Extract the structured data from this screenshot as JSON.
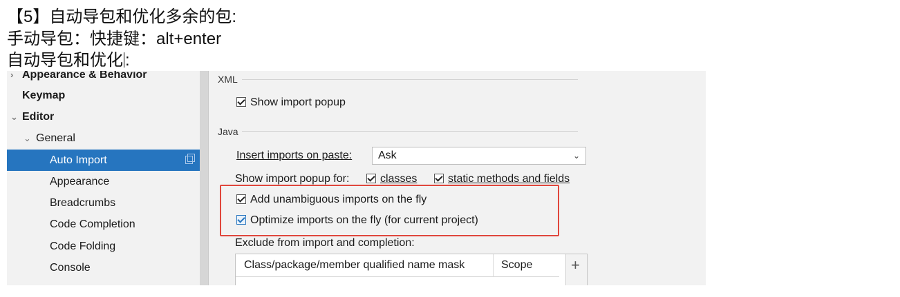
{
  "note": {
    "line1": "【5】自动导包和优化多余的包:",
    "line2": "手动导包：快捷键：alt+enter",
    "line3_before_caret": "自动导包和优化",
    "line3_after_caret": ":"
  },
  "sidebar": {
    "items": [
      {
        "label": "Appearance & Behavior",
        "bold": true,
        "expandable": true,
        "expanded": false
      },
      {
        "label": "Keymap",
        "bold": true
      },
      {
        "label": "Editor",
        "bold": true,
        "expandable": true,
        "expanded": true
      },
      {
        "label": "General",
        "expandable": true,
        "expanded": true
      },
      {
        "label": "Auto Import",
        "selected": true
      },
      {
        "label": "Appearance"
      },
      {
        "label": "Breadcrumbs"
      },
      {
        "label": "Code Completion"
      },
      {
        "label": "Code Folding"
      },
      {
        "label": "Console"
      }
    ]
  },
  "xml": {
    "section_label": "XML",
    "show_import_popup": {
      "label": "Show import popup",
      "checked": true
    }
  },
  "java": {
    "section_label": "Java",
    "insert_imports_label": "Insert imports on paste:",
    "insert_imports_value": "Ask",
    "show_popup_for_label": "Show import popup for:",
    "classes": {
      "label": "classes",
      "checked": true
    },
    "static_methods": {
      "label": "static methods and fields",
      "checked": true
    },
    "add_unambiguous": {
      "label": "Add unambiguous imports on the fly",
      "checked": true
    },
    "optimize_imports": {
      "label": "Optimize imports on the fly (for current project)",
      "checked": true
    },
    "exclude_label": "Exclude from import and completion:",
    "table": {
      "columns": [
        "Class/package/member qualified name mask",
        "Scope"
      ],
      "add_label": "+"
    }
  },
  "colors": {
    "selection": "#2675bf",
    "highlight_border": "#e0463c",
    "panel_bg": "#f2f2f2"
  }
}
